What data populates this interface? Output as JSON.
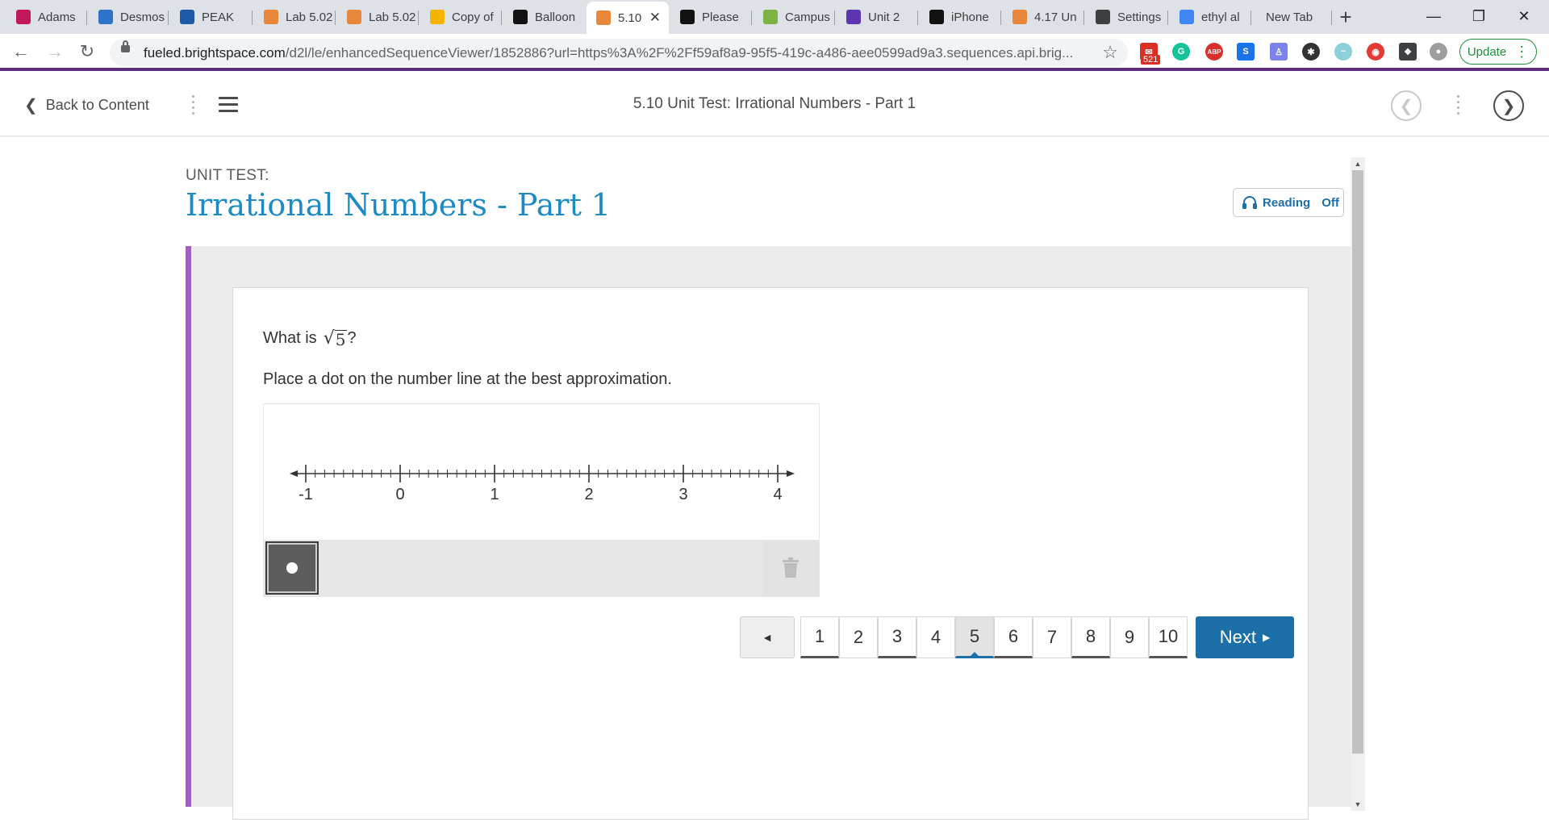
{
  "browser": {
    "tabs": [
      {
        "label": "Adams",
        "icon": "profile-icon",
        "color": "#c2185b"
      },
      {
        "label": "Desmos",
        "icon": "desmos-icon",
        "color": "#2f73c8"
      },
      {
        "label": "PEAK",
        "icon": "fe-icon",
        "color": "#1e5aa8"
      },
      {
        "label": "Lab 5.02",
        "icon": "brightspace-icon",
        "color": "#e8873a"
      },
      {
        "label": "Lab 5.02",
        "icon": "brightspace-icon",
        "color": "#e8873a"
      },
      {
        "label": "Copy of",
        "icon": "slides-icon",
        "color": "#f4b400"
      },
      {
        "label": "Balloon",
        "icon": "phet-icon",
        "color": "#111111"
      },
      {
        "label": "5.10",
        "icon": "brightspace-icon",
        "color": "#e8873a"
      },
      {
        "label": "Please",
        "icon": "brainly-icon",
        "color": "#111111"
      },
      {
        "label": "Campus",
        "icon": "campus-icon",
        "color": "#7cb342"
      },
      {
        "label": "Unit 2",
        "icon": "list-icon",
        "color": "#5e35b1"
      },
      {
        "label": "iPhone",
        "icon": "github-icon",
        "color": "#111111"
      },
      {
        "label": "4.17 Un",
        "icon": "brightspace-icon",
        "color": "#e8873a"
      },
      {
        "label": "Settings",
        "icon": "gear-icon",
        "color": "#3c4043"
      },
      {
        "label": "ethyl al",
        "icon": "google-icon",
        "color": "#4285f4"
      },
      {
        "label": "New Tab",
        "icon": "",
        "color": ""
      }
    ],
    "address": {
      "host": "fueled.brightspace.com",
      "path": "/d2l/le/enhancedSequenceViewer/1852886?url=https%3A%2F%2Ff59af8a9-95f5-419c-a486-aee0599ad9a3.sequences.api.brig..."
    },
    "extension_badge": "521",
    "update_label": "Update"
  },
  "lms": {
    "back_label": "Back to Content",
    "title": "5.10 Unit Test: Irrational Numbers - Part 1"
  },
  "page": {
    "unit_label": "UNIT TEST:",
    "unit_title": "Irrational Numbers - Part 1",
    "reading_label": "Reading",
    "reading_state": "Off"
  },
  "question": {
    "prefix": "What is",
    "radicand": "5",
    "suffix": "?",
    "instruction": "Place a dot on the number line at the best approximation."
  },
  "number_line": {
    "min": -1,
    "max": 4,
    "labels": [
      "-1",
      "0",
      "1",
      "2",
      "3",
      "4"
    ],
    "minor_ticks_per_unit": 10
  },
  "pager": {
    "prev_label": "◄",
    "pages": [
      "1",
      "2",
      "3",
      "4",
      "5",
      "6",
      "7",
      "8",
      "9",
      "10"
    ],
    "current": "5",
    "next_label": "Next"
  },
  "colors": {
    "accent_purple": "#a15fc2",
    "title_blue": "#1d8ac3",
    "button_blue": "#1d6fa8"
  }
}
